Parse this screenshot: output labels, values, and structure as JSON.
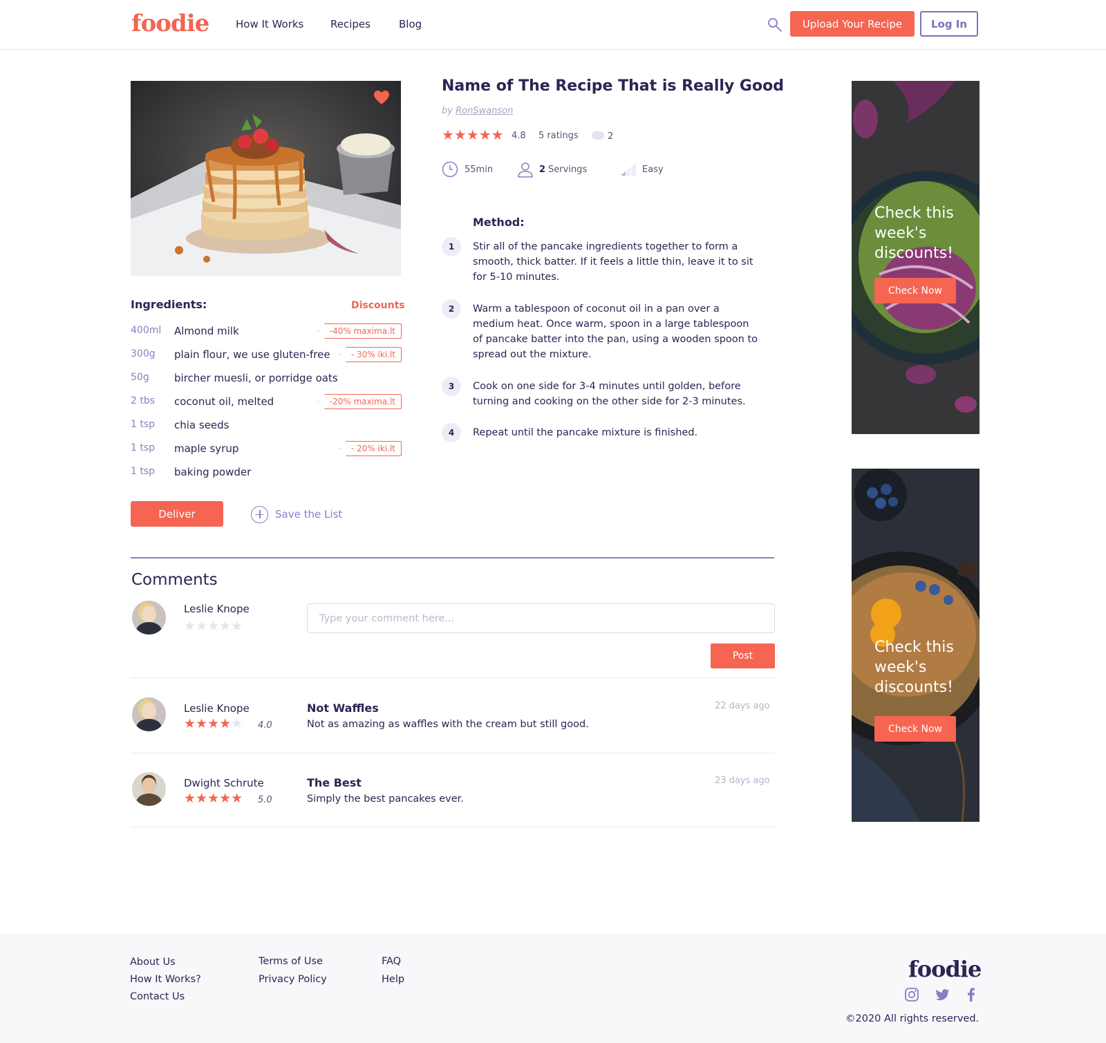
{
  "header": {
    "logo": "foodie",
    "nav": [
      "How It Works",
      "Recipes",
      "Blog"
    ],
    "upload_label": "Upload Your Recipe",
    "login_label": "Log In"
  },
  "recipe": {
    "title": "Name of The Recipe That is Really Good",
    "by": "by",
    "author": "RonSwanson",
    "stars": "★★★★★",
    "rating": "4.8",
    "ratings_count": "5 ratings",
    "comment_count": "2",
    "time": "55min",
    "servings_num": "2",
    "servings_label": "Servings",
    "difficulty": "Easy"
  },
  "ingredients": {
    "title": "Ingredients:",
    "discounts_label": "Discounts",
    "items": [
      {
        "qty": "400ml",
        "name": "Almond milk",
        "discount": "-40% maxima.lt"
      },
      {
        "qty": "300g",
        "name": "plain flour, we use gluten-free",
        "discount": "- 30% iki.lt"
      },
      {
        "qty": "50g",
        "name": "bircher muesli, or porridge oats",
        "discount": ""
      },
      {
        "qty": "2 tbs",
        "name": "coconut oil, melted",
        "discount": "-20% maxima.lt"
      },
      {
        "qty": "1 tsp",
        "name": "chia seeds",
        "discount": ""
      },
      {
        "qty": "1 tsp",
        "name": "maple syrup",
        "discount": "- 20% iki.lt"
      },
      {
        "qty": "1 tsp",
        "name": "baking powder",
        "discount": ""
      }
    ],
    "deliver_label": "Deliver",
    "save_label": "Save the List"
  },
  "method": {
    "title": "Method:",
    "steps": [
      {
        "num": "1",
        "text": "Stir all of the pancake ingredients together to form a smooth, thick batter. If it feels a little thin, leave it to sit for 5-10 minutes."
      },
      {
        "num": "2",
        "text": "Warm a tablespoon of coconut oil in a pan over a medium heat. Once warm, spoon in a large tablespoon of pancake batter into the pan, using a wooden spoon to spread out the mixture."
      },
      {
        "num": "3",
        "text": "Cook on one side for 3-4 minutes until golden, before turning and cooking on the other side for 2-3 minutes."
      },
      {
        "num": "4",
        "text": "Repeat until the pancake mixture is finished."
      }
    ]
  },
  "comments": {
    "title": "Comments",
    "composer": {
      "name": "Leslie Knope",
      "stars": "★★★★★",
      "placeholder": "Type your comment here...",
      "post_label": "Post"
    },
    "items": [
      {
        "name": "Leslie Knope",
        "stars_filled": "★★★★",
        "stars_empty": "★",
        "rating": "4.0",
        "title": "Not Waffles",
        "body": "Not as amazing as waffles with the cream but still good.",
        "date": "22 days ago"
      },
      {
        "name": "Dwight Schrute",
        "stars_filled": "★★★★★",
        "stars_empty": "",
        "rating": "5.0",
        "title": "The Best",
        "body": "Simply the best pancakes ever.",
        "date": "23 days ago"
      }
    ]
  },
  "ads": [
    {
      "text": "Check this week's discounts!",
      "button": "Check Now"
    },
    {
      "text": "Check this week's discounts!",
      "button": "Check Now"
    }
  ],
  "footer": {
    "col1": [
      "About Us",
      "How It Works?",
      "Contact Us"
    ],
    "col2": [
      "Terms of Use",
      "Privacy Policy"
    ],
    "col3": [
      "FAQ",
      "Help"
    ],
    "logo": "foodie",
    "social": [
      "instagram-icon",
      "twitter-icon",
      "facebook-icon"
    ],
    "copyright": "©2020  All rights reserved."
  },
  "colors": {
    "accent": "#f66452",
    "primary": "#2c2454",
    "secondary": "#8a7dc0"
  }
}
